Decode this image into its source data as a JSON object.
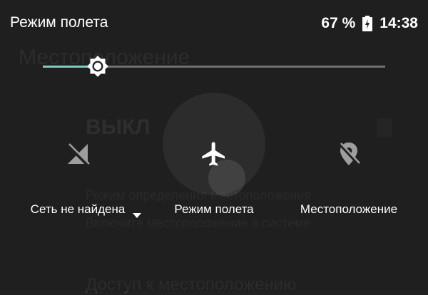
{
  "background_page": {
    "title": "Местоположение",
    "status": "ВЫКЛ",
    "line1": "Режим определения местоположения",
    "line2": "Включите местоположение в системе",
    "access": "Доступ к местоположению"
  },
  "status_bar": {
    "title": "Режим полета",
    "battery_pct": "67 %",
    "time": "14:38",
    "battery_icon": "battery-charging-icon"
  },
  "brightness": {
    "level": 0.16,
    "icon": "brightness-icon",
    "accent": "#80cbc4",
    "track_color": "#707070"
  },
  "tiles": [
    {
      "label": "Сеть не найдена",
      "icon": "no-signal-icon",
      "has_dropdown": true
    },
    {
      "label": "Режим полета",
      "icon": "airplane-icon",
      "state": "on"
    },
    {
      "label": "Местоположение",
      "icon": "location-off-icon",
      "state": "off"
    }
  ],
  "colors": {
    "background": "#212121",
    "tile_on": "#ffffff",
    "tile_off": "#9e9e9e"
  }
}
